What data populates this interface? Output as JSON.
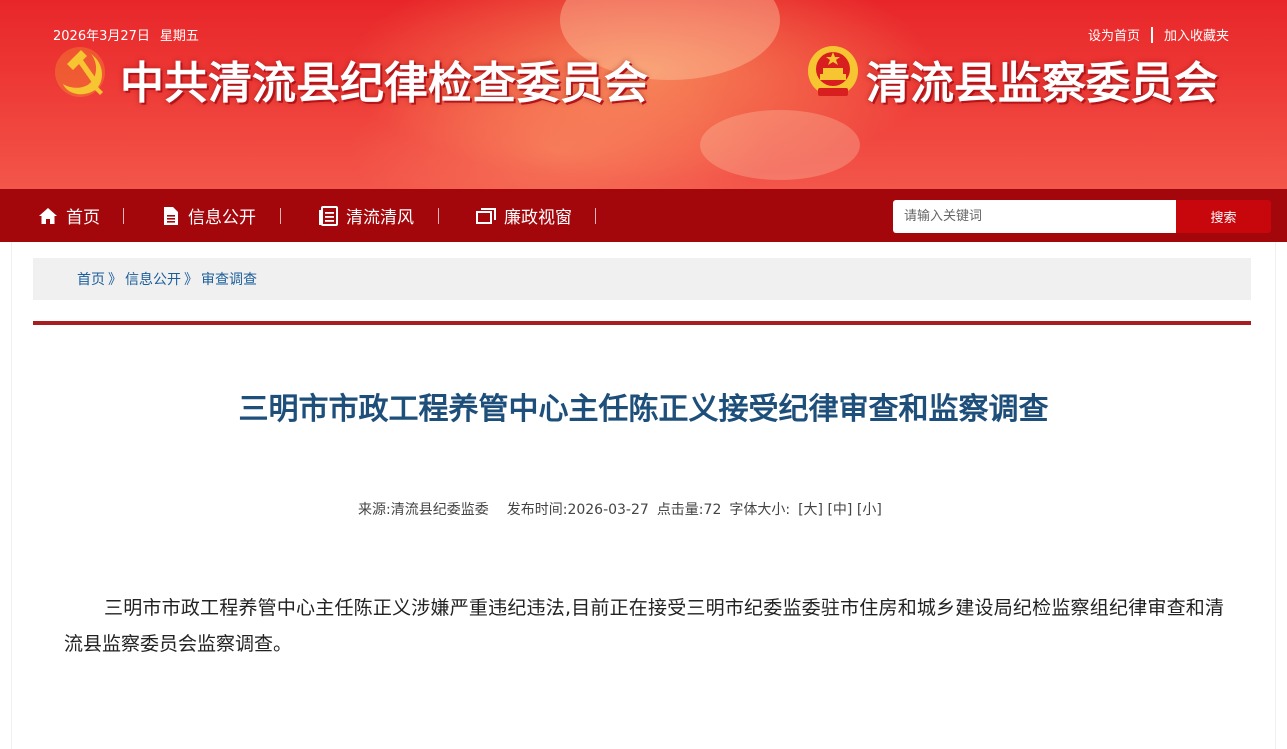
{
  "header": {
    "date": "2026年3月27日",
    "weekday": "星期五",
    "set_home_label": "设为首页",
    "add_favorite_label": "加入收藏夹",
    "title_left": "中共清流县纪律检查委员会",
    "title_right": "清流县监察委员会",
    "colors": {
      "banner_red": "#e8262a",
      "gold": "#f7c531"
    }
  },
  "nav": {
    "items": [
      {
        "label": "首页",
        "icon": "home-icon"
      },
      {
        "label": "信息公开",
        "icon": "document-icon"
      },
      {
        "label": "清流清风",
        "icon": "list-document-icon"
      },
      {
        "label": "廉政视窗",
        "icon": "window-icon"
      }
    ],
    "search": {
      "placeholder": "请输入关键词",
      "button_label": "搜索"
    },
    "colors": {
      "nav_bg": "#a4070b",
      "search_btn": "#c8070d"
    }
  },
  "breadcrumb": {
    "items": [
      "首页",
      "信息公开",
      "审查调查"
    ],
    "separator": "》"
  },
  "article": {
    "title": "三明市市政工程养管中心主任陈正义接受纪律审查和监察调查",
    "meta": {
      "source_label": "来源:",
      "source": "清流县纪委监委",
      "publish_label": "发布时间:",
      "publish_time": "2026-03-27",
      "views_label": "点击量:",
      "views": "72",
      "font_size_label": "字体大小:",
      "font_large": "[大]",
      "font_medium": "[中]",
      "font_small": "[小]"
    },
    "body": "三明市市政工程养管中心主任陈正义涉嫌严重违纪违法,目前正在接受三明市纪委监委驻市住房和城乡建设局纪检监察组纪律审查和清流县监察委员会监察调查。"
  }
}
